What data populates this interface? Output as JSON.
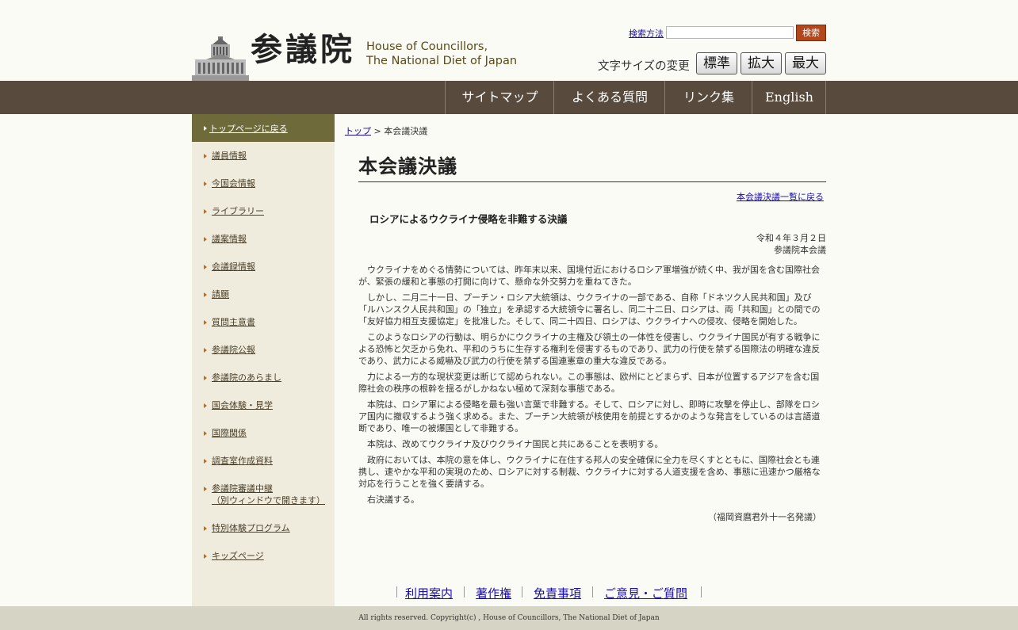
{
  "header": {
    "logo_kanji": "参議院",
    "logo_en_line1": "House of Councillors,",
    "logo_en_line2": "The National Diet of Japan",
    "search_link": "検索方法",
    "search_button": "検索",
    "fontsize_label": "文字サイズの変更",
    "fontsize_buttons": [
      "標準",
      "拡大",
      "最大"
    ]
  },
  "nav": {
    "items": [
      "サイトマップ",
      "よくある質問",
      "リンク集",
      "English"
    ]
  },
  "sidebar": {
    "top_link": "トップページに戻る",
    "items": [
      "議員情報",
      "今国会情報",
      "ライブラリー",
      "議案情報",
      "会議録情報",
      "請願",
      "質問主意書",
      "参議院公報",
      "参議院のあらまし",
      "国会体験・見学",
      "国際関係",
      "調査室作成資料",
      "参議院審議中継",
      "（別ウィンドウで開きます）",
      "特別体験プログラム",
      "キッズページ"
    ]
  },
  "breadcrumb": {
    "top": "トップ",
    "separator": " > ",
    "current": "本会議決議"
  },
  "main": {
    "title": "本会議決議",
    "back_link": "本会議決議一覧に戻る",
    "resolution_title": "ロシアによるウクライナ侵略を非難する決議",
    "date": "令和４年３月２日",
    "body_name": "参議院本会議",
    "paragraphs": [
      "ウクライナをめぐる情勢については、昨年末以来、国境付近におけるロシア軍増強が続く中、我が国を含む国際社会が、緊張の緩和と事態の打開に向けて、懸命な外交努力を重ねてきた。",
      "しかし、二月二十一日、プーチン・ロシア大統領は、ウクライナの一部である、自称「ドネツク人民共和国」及び「ルハンスク人民共和国」の「独立」を承認する大統領令に署名し、同二十二日、ロシアは、両「共和国」との間での「友好協力相互支援協定」を批准した。そして、同二十四日、ロシアは、ウクライナへの侵攻、侵略を開始した。",
      "このようなロシアの行動は、明らかにウクライナの主権及び領土の一体性を侵害し、ウクライナ国民が有する戦争による恐怖と欠乏から免れ、平和のうちに生存する権利を侵害するものであり、武力の行使を禁ずる国際法の明確な違反であり、武力による威嚇及び武力の行使を禁ずる国連憲章の重大な違反である。",
      "力による一方的な現状変更は断じて認められない。この事態は、欧州にとどまらず、日本が位置するアジアを含む国際社会の秩序の根幹を揺るがしかねない極めて深刻な事態である。",
      "本院は、ロシア軍による侵略を最も強い言葉で非難する。そして、ロシアに対し、即時に攻撃を停止し、部隊をロシア国内に撤収するよう強く求める。また、プーチン大統領が核使用を前提とするかのような発言をしているのは言語道断であり、唯一の被爆国として非難する。",
      "本院は、改めてウクライナ及びウクライナ国民と共にあることを表明する。",
      "政府においては、本院の意を体し、ウクライナに在住する邦人の安全確保に全力を尽くすとともに、国際社会とも連携し、速やかな平和の実現のため、ロシアに対する制裁、ウクライナに対する人道支援を含め、事態に迅速かつ厳格な対応を行うことを強く要請する。",
      "右決議する。"
    ],
    "proposer": "（福岡資麿君外十一名発議）"
  },
  "footer": {
    "links": [
      "利用案内",
      "著作権",
      "免責事項",
      "ご意見・ご質問"
    ],
    "copyright": "All rights reserved. Copyright(c) , House of Councillors, The National Diet of Japan"
  }
}
